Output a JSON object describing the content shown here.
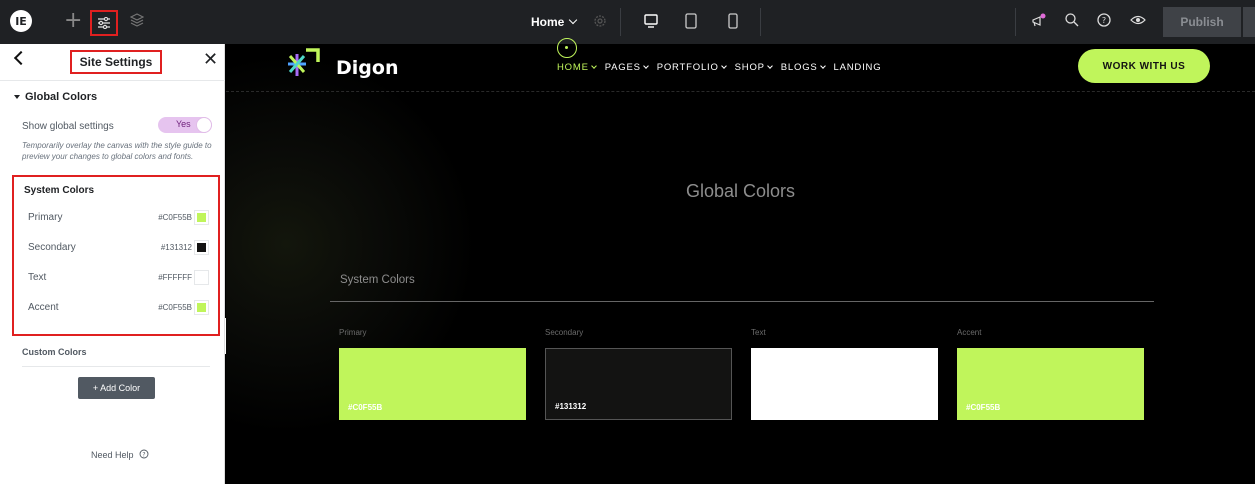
{
  "topbar": {
    "page_label": "Home",
    "publish_label": "Publish"
  },
  "panel": {
    "title": "Site Settings",
    "section_title": "Global Colors",
    "show_global_label": "Show global settings",
    "toggle_label": "Yes",
    "help_text": "Temporarily overlay the canvas with the style guide to preview your changes to global colors and fonts.",
    "system_colors_title": "System Colors",
    "system_colors": [
      {
        "name": "Primary",
        "hex": "#C0F55B",
        "color": "#C0F55B"
      },
      {
        "name": "Secondary",
        "hex": "#131312",
        "color": "#131312"
      },
      {
        "name": "Text",
        "hex": "#FFFFFF",
        "color": "#FFFFFF"
      },
      {
        "name": "Accent",
        "hex": "#C0F55B",
        "color": "#C0F55B"
      }
    ],
    "custom_colors_title": "Custom Colors",
    "add_color_label": "+ Add Color",
    "need_help_label": "Need Help"
  },
  "site": {
    "brand": "Digon",
    "nav": [
      "HOME",
      "PAGES",
      "PORTFOLIO",
      "SHOP",
      "BLOGS",
      "LANDING"
    ],
    "cta_label": "WORK WITH US",
    "accent_color": "#C0F55B",
    "page_title": "Global Colors",
    "section_title": "System Colors",
    "swatches": [
      {
        "label": "Primary",
        "hex": "#C0F55B",
        "color": "#C0F55B"
      },
      {
        "label": "Secondary",
        "hex": "#131312",
        "color": "#131312"
      },
      {
        "label": "Text",
        "hex": "",
        "color": "#FFFFFF"
      },
      {
        "label": "Accent",
        "hex": "#C0F55B",
        "color": "#C0F55B"
      }
    ]
  }
}
